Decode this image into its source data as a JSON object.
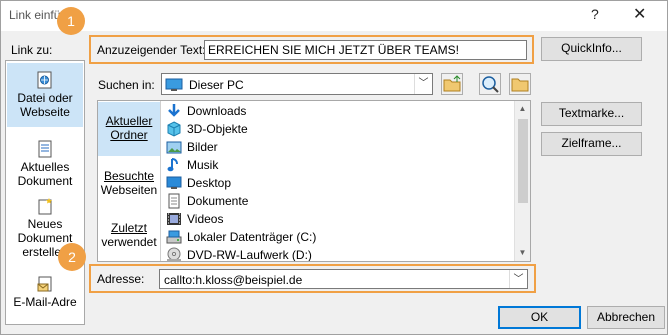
{
  "window": {
    "title": "Link einfü",
    "help_glyph": "?",
    "close_glyph": "✕"
  },
  "link_to": {
    "label": "Link zu:",
    "items": [
      {
        "line1": "Datei oder",
        "line2": "Webseite",
        "icon": "web-page-icon"
      },
      {
        "line1": "Aktuelles",
        "line2": "Dokument",
        "icon": "document-icon"
      },
      {
        "line1": "Neues",
        "line2": "Dokument",
        "line3": "erstellen",
        "icon": "new-document-icon"
      },
      {
        "line1": "E-Mail-Adre",
        "icon": "email-icon"
      }
    ]
  },
  "display_text": {
    "label": "Anzuzeigender Text:",
    "value": "ERREICHEN SIE MICH JETZT ÜBER TEAMS!"
  },
  "quickinfo_button": "QuickInfo...",
  "look_in": {
    "label": "Suchen in:",
    "value": "Dieser PC"
  },
  "browse_nav": [
    {
      "line1": "Aktueller",
      "line2": "Ordner"
    },
    {
      "line1": "Besuchte",
      "line2": "Webseiten"
    },
    {
      "line1": "Zuletzt",
      "line2": "verwendet"
    }
  ],
  "files": [
    {
      "name": "Downloads",
      "icon": "download-arrow-icon"
    },
    {
      "name": "3D-Objekte",
      "icon": "cube-icon"
    },
    {
      "name": "Bilder",
      "icon": "pictures-icon"
    },
    {
      "name": "Musik",
      "icon": "music-note-icon"
    },
    {
      "name": "Desktop",
      "icon": "desktop-icon"
    },
    {
      "name": "Dokumente",
      "icon": "documents-icon"
    },
    {
      "name": "Videos",
      "icon": "film-icon"
    },
    {
      "name": "Lokaler Datenträger (C:)",
      "icon": "hard-drive-icon"
    },
    {
      "name": "DVD-RW-Laufwerk (D:)",
      "icon": "dvd-drive-icon"
    }
  ],
  "bookmark_button": "Textmarke...",
  "target_frame_button": "Zielframe...",
  "address": {
    "label": "Adresse:",
    "value": "callto:h.kloss@beispiel.de"
  },
  "ok_button": "OK",
  "cancel_button": "Abbrechen",
  "badges": [
    "1",
    "2"
  ],
  "colors": {
    "highlight": "#f0a045",
    "selection": "#cce4f7",
    "accent": "#0078d7"
  }
}
